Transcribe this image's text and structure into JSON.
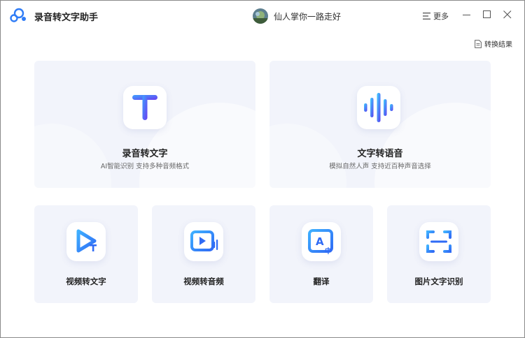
{
  "app": {
    "title": "录音转文字助手"
  },
  "user": {
    "name": "仙人掌你一路走好"
  },
  "header": {
    "more_label": "更多"
  },
  "toolbar": {
    "result_label": "转换结果"
  },
  "features_main": [
    {
      "title": "录音转文字",
      "subtitle": "AI智能识别 支持多种音频格式",
      "icon": "text-t-icon"
    },
    {
      "title": "文字转语音",
      "subtitle": "模拟自然人声 支持近百种声音选择",
      "icon": "sound-wave-icon"
    }
  ],
  "features_small": [
    {
      "title": "视频转文字",
      "icon": "video-to-text-icon"
    },
    {
      "title": "视频转音频",
      "icon": "video-to-audio-icon"
    },
    {
      "title": "翻译",
      "icon": "translate-icon"
    },
    {
      "title": "图片文字识别",
      "icon": "image-ocr-icon"
    }
  ],
  "colors": {
    "accent": "#2f6bf5",
    "card_bg": "#f2f4fb"
  }
}
